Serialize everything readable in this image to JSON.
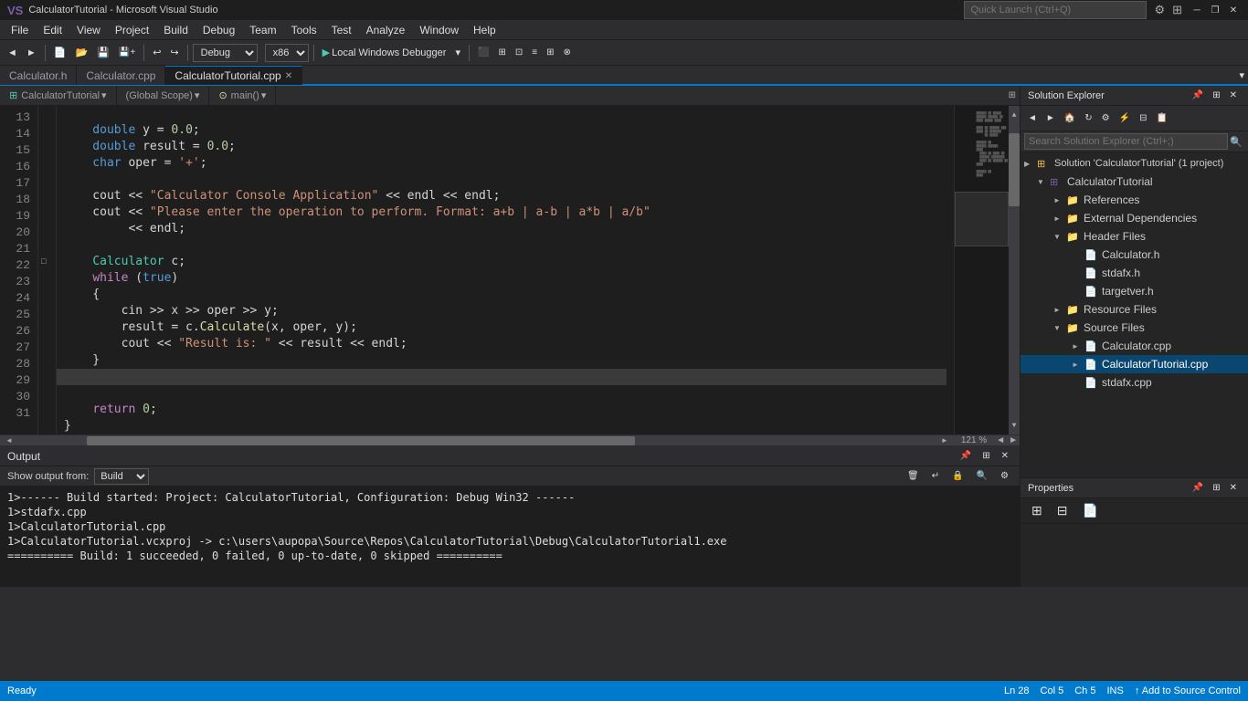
{
  "titlebar": {
    "icon": "VS",
    "title": "CalculatorTutorial - Microsoft Visual Studio",
    "minimize_label": "─",
    "restore_label": "❐",
    "close_label": "✕"
  },
  "menubar": {
    "items": [
      "File",
      "Edit",
      "View",
      "Project",
      "Build",
      "Debug",
      "Team",
      "Tools",
      "Test",
      "Analyze",
      "Window",
      "Help"
    ]
  },
  "toolbar": {
    "back_label": "◄",
    "forward_label": "►",
    "new_label": "📄",
    "open_label": "📂",
    "save_label": "💾",
    "save_all_label": "💾",
    "config_label": "Debug",
    "platform_label": "x86",
    "run_label": "▶",
    "debugger_label": "Local Windows Debugger",
    "quicklaunch_placeholder": "Quick Launch (Ctrl+Q)"
  },
  "tabs": [
    {
      "label": "Calculator.h",
      "active": false,
      "modified": false
    },
    {
      "label": "Calculator.cpp",
      "active": false,
      "modified": false
    },
    {
      "label": "CalculatorTutorial.cpp",
      "active": true,
      "modified": false
    }
  ],
  "code_nav": {
    "project": "CalculatorTutorial",
    "scope": "(Global Scope)",
    "function": "main()"
  },
  "code": {
    "lines": [
      {
        "num": 13,
        "text": "    double y = 0.0;"
      },
      {
        "num": 14,
        "text": "    double result = 0.0;"
      },
      {
        "num": 15,
        "text": "    char oper = '+';"
      },
      {
        "num": 16,
        "text": ""
      },
      {
        "num": 17,
        "text": "    cout << \"Calculator Console Application\" << endl << endl;"
      },
      {
        "num": 18,
        "text": "    cout << \"Please enter the operation to perform. Format: a+b | a-b | a*b | a/b\""
      },
      {
        "num": 19,
        "text": "         << endl;"
      },
      {
        "num": 20,
        "text": ""
      },
      {
        "num": 21,
        "text": "    Calculator c;"
      },
      {
        "num": 22,
        "text": "    while (true)"
      },
      {
        "num": 23,
        "text": "    {"
      },
      {
        "num": 24,
        "text": "        cin >> x >> oper >> y;"
      },
      {
        "num": 25,
        "text": "        result = c.Calculate(x, oper, y);"
      },
      {
        "num": 26,
        "text": "        cout << \"Result is: \" << result << endl;"
      },
      {
        "num": 27,
        "text": "    }"
      },
      {
        "num": 28,
        "text": ""
      },
      {
        "num": 29,
        "text": "    return 0;"
      },
      {
        "num": 30,
        "text": "}"
      },
      {
        "num": 31,
        "text": ""
      }
    ],
    "zoom": "121 %",
    "cursor_line": "Ln 28",
    "cursor_col": "Col 5",
    "cursor_ch": "Ch 5",
    "insert_mode": "INS"
  },
  "solution_explorer": {
    "title": "Solution Explorer",
    "search_placeholder": "Search Solution Explorer (Ctrl+;)",
    "tree": {
      "solution": "Solution 'CalculatorTutorial' (1 project)",
      "project": "CalculatorTutorial",
      "nodes": [
        {
          "label": "References",
          "indent": 2,
          "expanded": false,
          "type": "folder"
        },
        {
          "label": "External Dependencies",
          "indent": 2,
          "expanded": false,
          "type": "folder"
        },
        {
          "label": "Header Files",
          "indent": 2,
          "expanded": true,
          "type": "folder",
          "children": [
            {
              "label": "Calculator.h",
              "indent": 3,
              "type": "file-h"
            },
            {
              "label": "stdafx.h",
              "indent": 3,
              "type": "file-h"
            },
            {
              "label": "targetver.h",
              "indent": 3,
              "type": "file-h"
            }
          ]
        },
        {
          "label": "Resource Files",
          "indent": 2,
          "expanded": false,
          "type": "folder"
        },
        {
          "label": "Source Files",
          "indent": 2,
          "expanded": true,
          "type": "folder",
          "children": [
            {
              "label": "Calculator.cpp",
              "indent": 3,
              "type": "file-cpp"
            },
            {
              "label": "CalculatorTutorial.cpp",
              "indent": 3,
              "type": "file-cpp",
              "selected": true
            },
            {
              "label": "stdafx.cpp",
              "indent": 3,
              "type": "file-cpp"
            }
          ]
        }
      ]
    }
  },
  "properties": {
    "title": "Properties"
  },
  "output": {
    "title": "Output",
    "show_output_from_label": "Show output from:",
    "show_output_from_value": "Build",
    "lines": [
      "1>------ Build started: Project: CalculatorTutorial, Configuration: Debug Win32 ------",
      "1>stdafx.cpp",
      "1>CalculatorTutorial.cpp",
      "1>CalculatorTutorial.vcxproj -> c:\\users\\aupopa\\Source\\Repos\\CalculatorTutorial\\Debug\\CalculatorTutorial1.exe",
      "========== Build: 1 succeeded, 0 failed, 0 up-to-date, 0 skipped =========="
    ]
  },
  "statusbar": {
    "ready": "Ready",
    "add_to_source": "Add to Source Control",
    "ln": "Ln 28",
    "col": "Col 5",
    "ch": "Ch 5",
    "ins": "INS"
  }
}
